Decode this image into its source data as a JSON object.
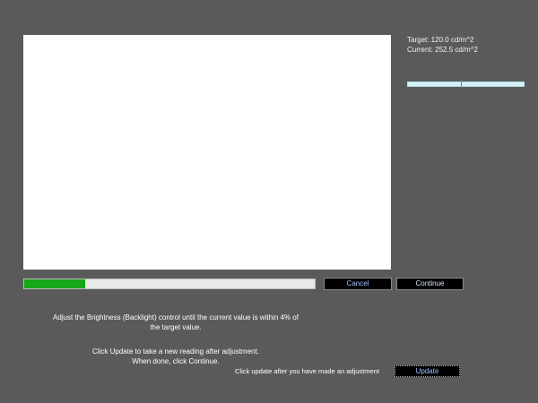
{
  "readout": {
    "target_text": "Target: 120.0 cd/m^2",
    "current_text": "Current: 252.5 cd/m^2"
  },
  "meter": {
    "marker_fraction": 0.46
  },
  "progress": {
    "fraction": 0.21,
    "fill_color": "#17a817"
  },
  "buttons": {
    "cancel": "Cancel",
    "continue": "Continue",
    "update": "Update"
  },
  "instructions": {
    "line1": "Adjust the Brightness (Backlight) control until the current value is within 4% of",
    "line2": "the target value.",
    "line3": "Click Update to take a new reading after adjustment.",
    "line4": "When done, click Continue."
  },
  "update_hint": "Click update after you have made an adjustment"
}
